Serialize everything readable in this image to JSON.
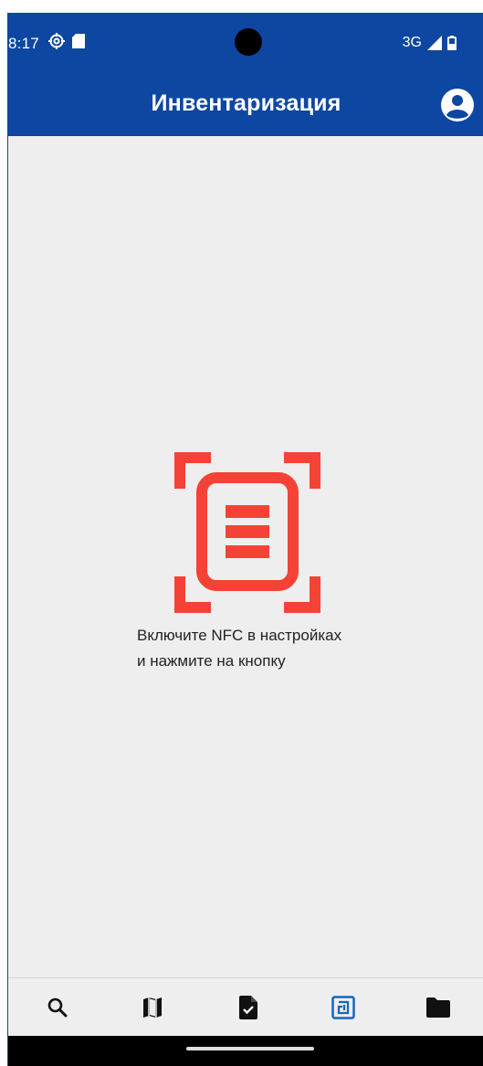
{
  "status_bar": {
    "time": "8:17",
    "network": "3G",
    "left_icons": [
      "settings-gear-icon",
      "sd-card-icon"
    ],
    "right_icons": [
      "signal-icon",
      "battery-icon"
    ]
  },
  "app_bar": {
    "title": "Инвентаризация",
    "account_icon": "account-circle-icon"
  },
  "content": {
    "illustration_icon": "nfc-document-scan-icon",
    "hint_line1": "Включите NFC в настройках",
    "hint_line2": "и нажмите на кнопку"
  },
  "bottom_nav": {
    "items": [
      {
        "icon": "search-icon",
        "active": false
      },
      {
        "icon": "map-icon",
        "active": false
      },
      {
        "icon": "document-check-icon",
        "active": false
      },
      {
        "icon": "nfc-icon",
        "active": true
      },
      {
        "icon": "folder-icon",
        "active": false
      }
    ]
  },
  "colors": {
    "primary": "#0d47a1",
    "accent_red": "#f44336",
    "background": "#eeeeee",
    "active_nav": "#1565c0"
  }
}
